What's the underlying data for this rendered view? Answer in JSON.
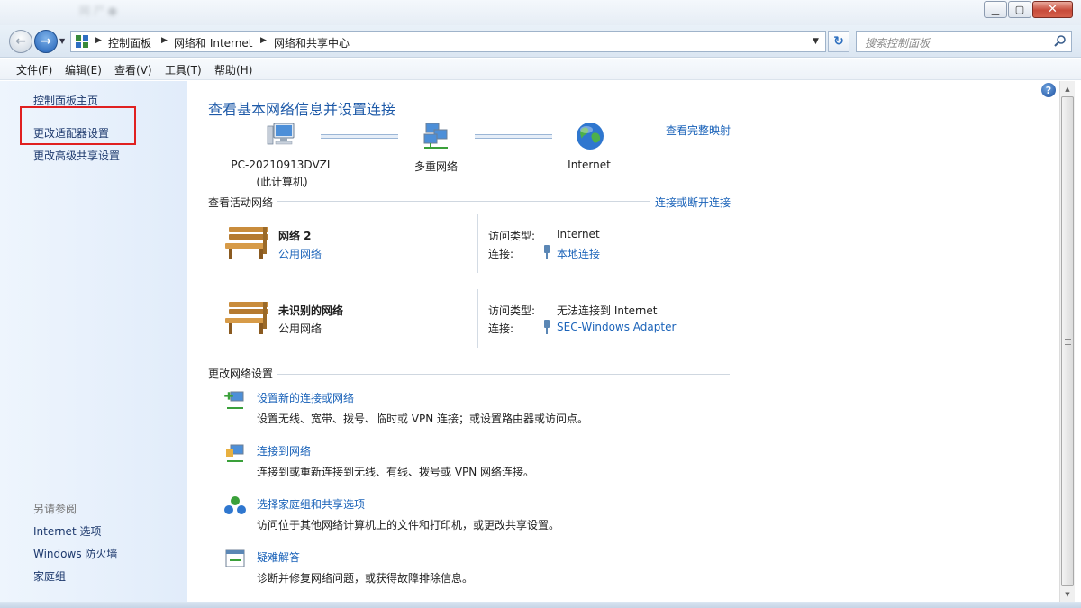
{
  "window": {
    "title_blurred": "网 尸 ●"
  },
  "address": {
    "crumbs": [
      "控制面板",
      "网络和 Internet",
      "网络和共享中心"
    ],
    "search_placeholder": "搜索控制面板"
  },
  "menu": [
    "文件(F)",
    "编辑(E)",
    "查看(V)",
    "工具(T)",
    "帮助(H)"
  ],
  "sidebar": {
    "links": [
      "控制面板主页",
      "更改适配器设置",
      "更改高级共享设置"
    ],
    "see_also_header": "另请参阅",
    "see_also": [
      "Internet 选项",
      "Windows 防火墙",
      "家庭组"
    ]
  },
  "main": {
    "title": "查看基本网络信息并设置连接",
    "map_link": "查看完整映射",
    "nodes": [
      {
        "label": "PC-20210913DVZL",
        "sub": "(此计算机)"
      },
      {
        "label": "多重网络"
      },
      {
        "label": "Internet"
      }
    ],
    "active_header": "查看活动网络",
    "connect_link": "连接或断开连接",
    "networks": [
      {
        "name": "网络  2",
        "category": "公用网络",
        "access_key": "访问类型:",
        "access_value": "Internet",
        "conn_key": "连接:",
        "conn_value": "本地连接"
      },
      {
        "name": "未识别的网络",
        "category": "公用网络",
        "access_key": "访问类型:",
        "access_value": "无法连接到 Internet",
        "conn_key": "连接:",
        "conn_value": "SEC-Windows Adapter"
      }
    ],
    "change_header": "更改网络设置",
    "tasks": [
      {
        "title": "设置新的连接或网络",
        "desc": "设置无线、宽带、拨号、临时或 VPN 连接；或设置路由器或访问点。"
      },
      {
        "title": "连接到网络",
        "desc": "连接到或重新连接到无线、有线、拨号或 VPN 网络连接。"
      },
      {
        "title": "选择家庭组和共享选项",
        "desc": "访问位于其他网络计算机上的文件和打印机，或更改共享设置。"
      },
      {
        "title": "疑难解答",
        "desc": "诊断并修复网络问题，或获得故障排除信息。"
      }
    ]
  },
  "colors": {
    "link": "#1b63b9",
    "title": "#1e5aa8",
    "highlight": "#e02020",
    "sidebar_bg": "#e7f0fb"
  }
}
